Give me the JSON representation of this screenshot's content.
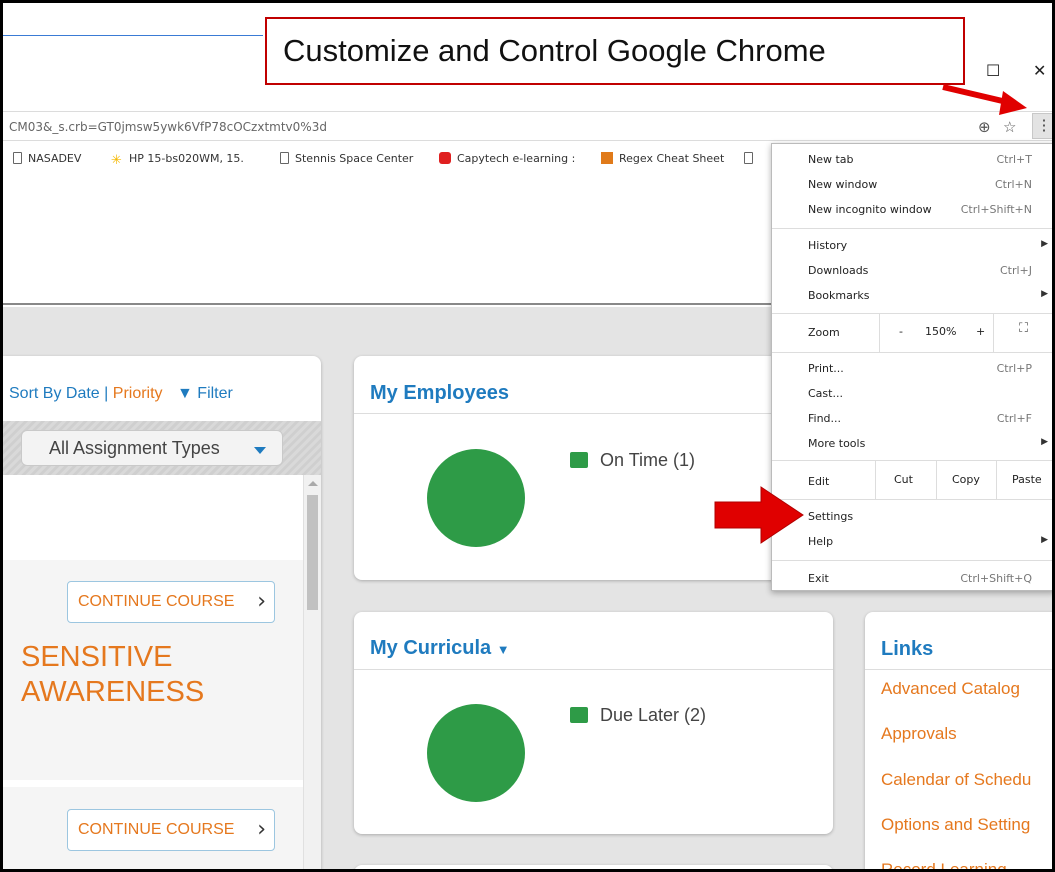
{
  "browser": {
    "url_fragment": "CM03&_s.crb=GT0jmsw5ywk6VfP78cOCzxtmtv0%3d",
    "window_buttons": {
      "maximize": "☐",
      "close": "✕"
    },
    "bookmarks": [
      {
        "label": "NASADEV",
        "icon": "document-icon"
      },
      {
        "label": "HP 15-bs020WM, 15.",
        "icon": "walmart-spark-icon"
      },
      {
        "label": "Stennis Space Center",
        "icon": "document-icon"
      },
      {
        "label": "Capytech e-learning :",
        "icon": "youtube-icon"
      },
      {
        "label": "Regex Cheat Sheet",
        "icon": "regex-icon"
      }
    ]
  },
  "callout": {
    "text": "Customize and Control Google Chrome",
    "color": "#c00000"
  },
  "left_panel": {
    "sort_by": "Sort By Date",
    "divider": "|",
    "priority": "Priority",
    "filter": "Filter",
    "type_select": "All Assignment Types",
    "continue_label": "CONTINUE COURSE",
    "course_title_line1": "SENSITIVE",
    "course_title_line2": "AWARENESS"
  },
  "employees_card": {
    "title": "My Employees",
    "legend": "On Time (1)"
  },
  "curricula_card": {
    "title": "My Curricula",
    "legend": "Due Later (2)"
  },
  "links_card": {
    "title": "Links",
    "items": [
      "Advanced Catalog",
      "Approvals",
      "Calendar of Schedu",
      "Options and Setting",
      "Record Learning"
    ]
  },
  "chrome_menu": {
    "new_tab": "New tab",
    "new_tab_sc": "Ctrl+T",
    "new_window": "New window",
    "new_window_sc": "Ctrl+N",
    "new_incognito": "New incognito window",
    "new_incognito_sc": "Ctrl+Shift+N",
    "history": "History",
    "downloads": "Downloads",
    "downloads_sc": "Ctrl+J",
    "bookmarks": "Bookmarks",
    "zoom": "Zoom",
    "zoom_minus": "-",
    "zoom_level": "150%",
    "zoom_plus": "+",
    "print": "Print...",
    "print_sc": "Ctrl+P",
    "cast": "Cast...",
    "find": "Find...",
    "find_sc": "Ctrl+F",
    "more_tools": "More tools",
    "edit": "Edit",
    "cut": "Cut",
    "copy": "Copy",
    "paste": "Paste",
    "settings": "Settings",
    "help": "Help",
    "exit": "Exit",
    "exit_sc": "Ctrl+Shift+Q"
  },
  "colors": {
    "accent_blue": "#1f7bbf",
    "accent_orange": "#e5781e",
    "pie_green": "#2e9b47",
    "arrow_red": "#e00000"
  }
}
